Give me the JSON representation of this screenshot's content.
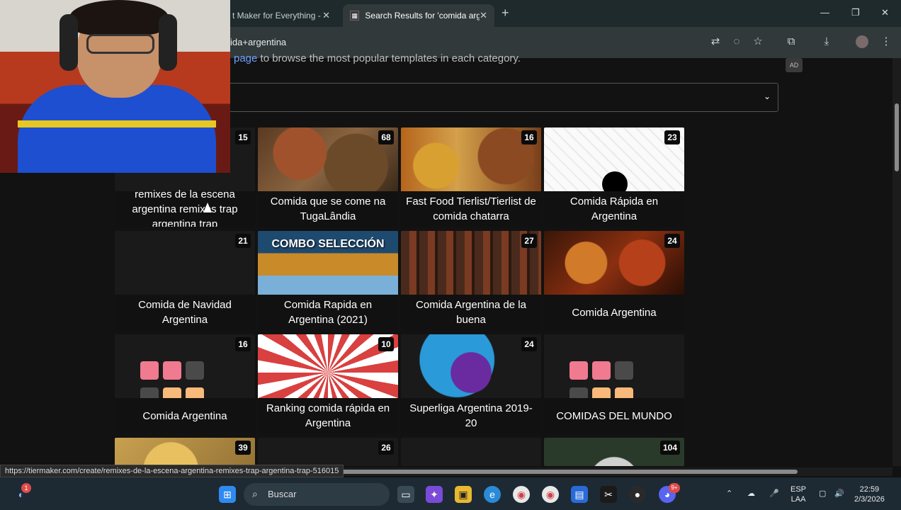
{
  "browser": {
    "tabs": [
      {
        "title": "t Maker for Everything -",
        "active": false
      },
      {
        "title": "Search Results for 'comida arge",
        "active": true
      }
    ],
    "url": "ida+argentina",
    "status_url": "https://tiermaker.com/create/remixes-de-la-escena-argentina-remixes-trap-argentina-trap-516015"
  },
  "page": {
    "intro_link": "page",
    "intro_rest": " to browse the most popular templates in each category.",
    "ad_badge": "AD"
  },
  "cards": [
    {
      "title": "remixes de la escena argentina remixes trap argentina trap",
      "count": "15"
    },
    {
      "title": "Comida que se come na TugaLândia",
      "count": "68"
    },
    {
      "title": "Fast Food Tierlist/Tierlist de comida chatarra",
      "count": "16"
    },
    {
      "title": "Comida Rápida en Argentina",
      "count": "23"
    },
    {
      "title": "Comida de Navidad Argentina",
      "count": "21"
    },
    {
      "title": "Comida Rapida en Argentina (2021)",
      "count": "",
      "banner": "COMBO SELECCIÓN"
    },
    {
      "title": "Comida Argentina de la buena",
      "count": "27"
    },
    {
      "title": "Comida Argentina",
      "count": "24"
    },
    {
      "title": "Comida Argentina",
      "count": "16"
    },
    {
      "title": "Ranking comida rápida en Argentina",
      "count": "10"
    },
    {
      "title": "Superliga Argentina 2019-20",
      "count": "24"
    },
    {
      "title": "COMIDAS DEL MUNDO",
      "count": ""
    },
    {
      "title": "",
      "count": "39"
    },
    {
      "title": "",
      "count": "26"
    },
    {
      "title": "",
      "count": ""
    },
    {
      "title": "",
      "count": "104"
    }
  ],
  "taskbar": {
    "search_label": "Buscar",
    "lang_line1": "ESP",
    "lang_line2": "LAA",
    "time": "22:59",
    "date": "2/3/2026",
    "badge_copilot": "1",
    "badge_discord": "9+"
  },
  "colors": {
    "tile_pink": "#f07a90",
    "tile_peach": "#f9b97a",
    "tile_gray": "#4a4a4a",
    "tile_yellow": "#f3ea7a",
    "link": "#6fa0ff"
  }
}
